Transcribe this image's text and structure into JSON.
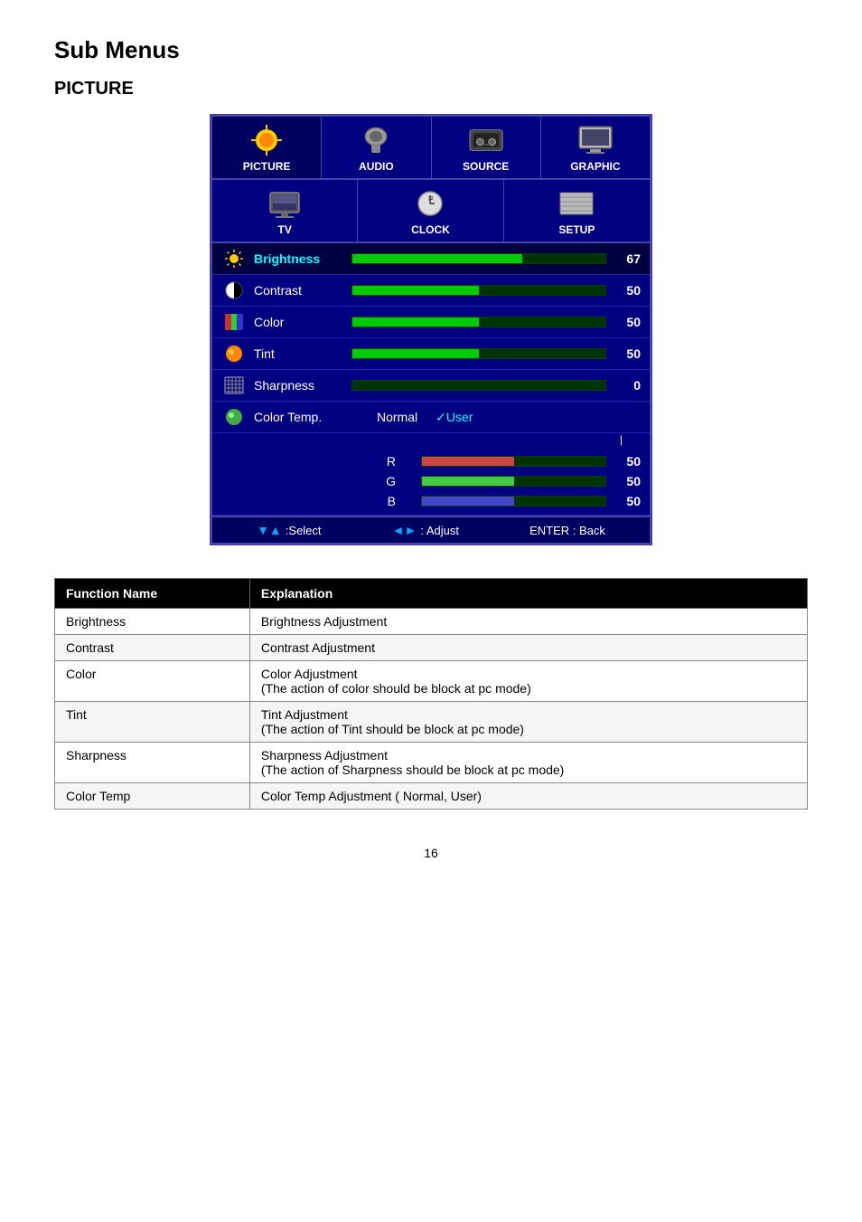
{
  "page": {
    "title": "Sub Menus",
    "section": "PICTURE",
    "page_number": "16"
  },
  "osd": {
    "tabs_row1": [
      {
        "id": "picture",
        "label": "PICTURE",
        "active": true
      },
      {
        "id": "audio",
        "label": "AUDIO",
        "active": false
      },
      {
        "id": "source",
        "label": "SOURCE",
        "active": false
      },
      {
        "id": "graphic",
        "label": "GRAPHIC",
        "active": false
      }
    ],
    "tabs_row2": [
      {
        "id": "tv",
        "label": "TV"
      },
      {
        "id": "clock",
        "label": "CLOCK"
      },
      {
        "id": "setup",
        "label": "SETUP"
      }
    ],
    "menu_items": [
      {
        "id": "brightness",
        "label": "Brightness",
        "value": 67,
        "bar_pct": 67,
        "active": true
      },
      {
        "id": "contrast",
        "label": "Contrast",
        "value": 50,
        "bar_pct": 50,
        "active": false
      },
      {
        "id": "color",
        "label": "Color",
        "value": 50,
        "bar_pct": 50,
        "active": false
      },
      {
        "id": "tint",
        "label": "Tint",
        "value": 50,
        "bar_pct": 50,
        "active": false
      },
      {
        "id": "sharpness",
        "label": "Sharpness",
        "value": 0,
        "bar_pct": 0,
        "active": false
      }
    ],
    "colortemp": {
      "label": "Color Temp.",
      "options": [
        {
          "id": "normal",
          "label": "Normal",
          "selected": false
        },
        {
          "id": "user",
          "label": "✓User",
          "selected": true
        }
      ]
    },
    "rgb": [
      {
        "id": "r",
        "label": "R",
        "value": 50,
        "bar_pct": 50
      },
      {
        "id": "g",
        "label": "G",
        "value": 50,
        "bar_pct": 50
      },
      {
        "id": "b",
        "label": "B",
        "value": 50,
        "bar_pct": 50
      }
    ],
    "controls": [
      {
        "id": "select",
        "arrows": "▼▲",
        "label": ":Select"
      },
      {
        "id": "adjust",
        "arrows": "◄►",
        "label": ": Adjust"
      },
      {
        "id": "back",
        "label": "ENTER : Back"
      }
    ]
  },
  "table": {
    "headers": [
      "Function Name",
      "Explanation"
    ],
    "rows": [
      {
        "name": "Brightness",
        "explanation_lines": [
          "Brightness Adjustment"
        ]
      },
      {
        "name": "Contrast",
        "explanation_lines": [
          "Contrast Adjustment"
        ]
      },
      {
        "name": "Color",
        "explanation_lines": [
          "Color Adjustment",
          "(The action of color should be block at pc mode)"
        ]
      },
      {
        "name": "Tint",
        "explanation_lines": [
          "Tint Adjustment",
          "(The action of Tint should be block at pc mode)"
        ]
      },
      {
        "name": "Sharpness",
        "explanation_lines": [
          "Sharpness Adjustment",
          "(The action of Sharpness should be block at pc mode)"
        ]
      },
      {
        "name": "Color Temp",
        "explanation_lines": [
          "Color Temp Adjustment ( Normal, User)"
        ]
      }
    ]
  }
}
